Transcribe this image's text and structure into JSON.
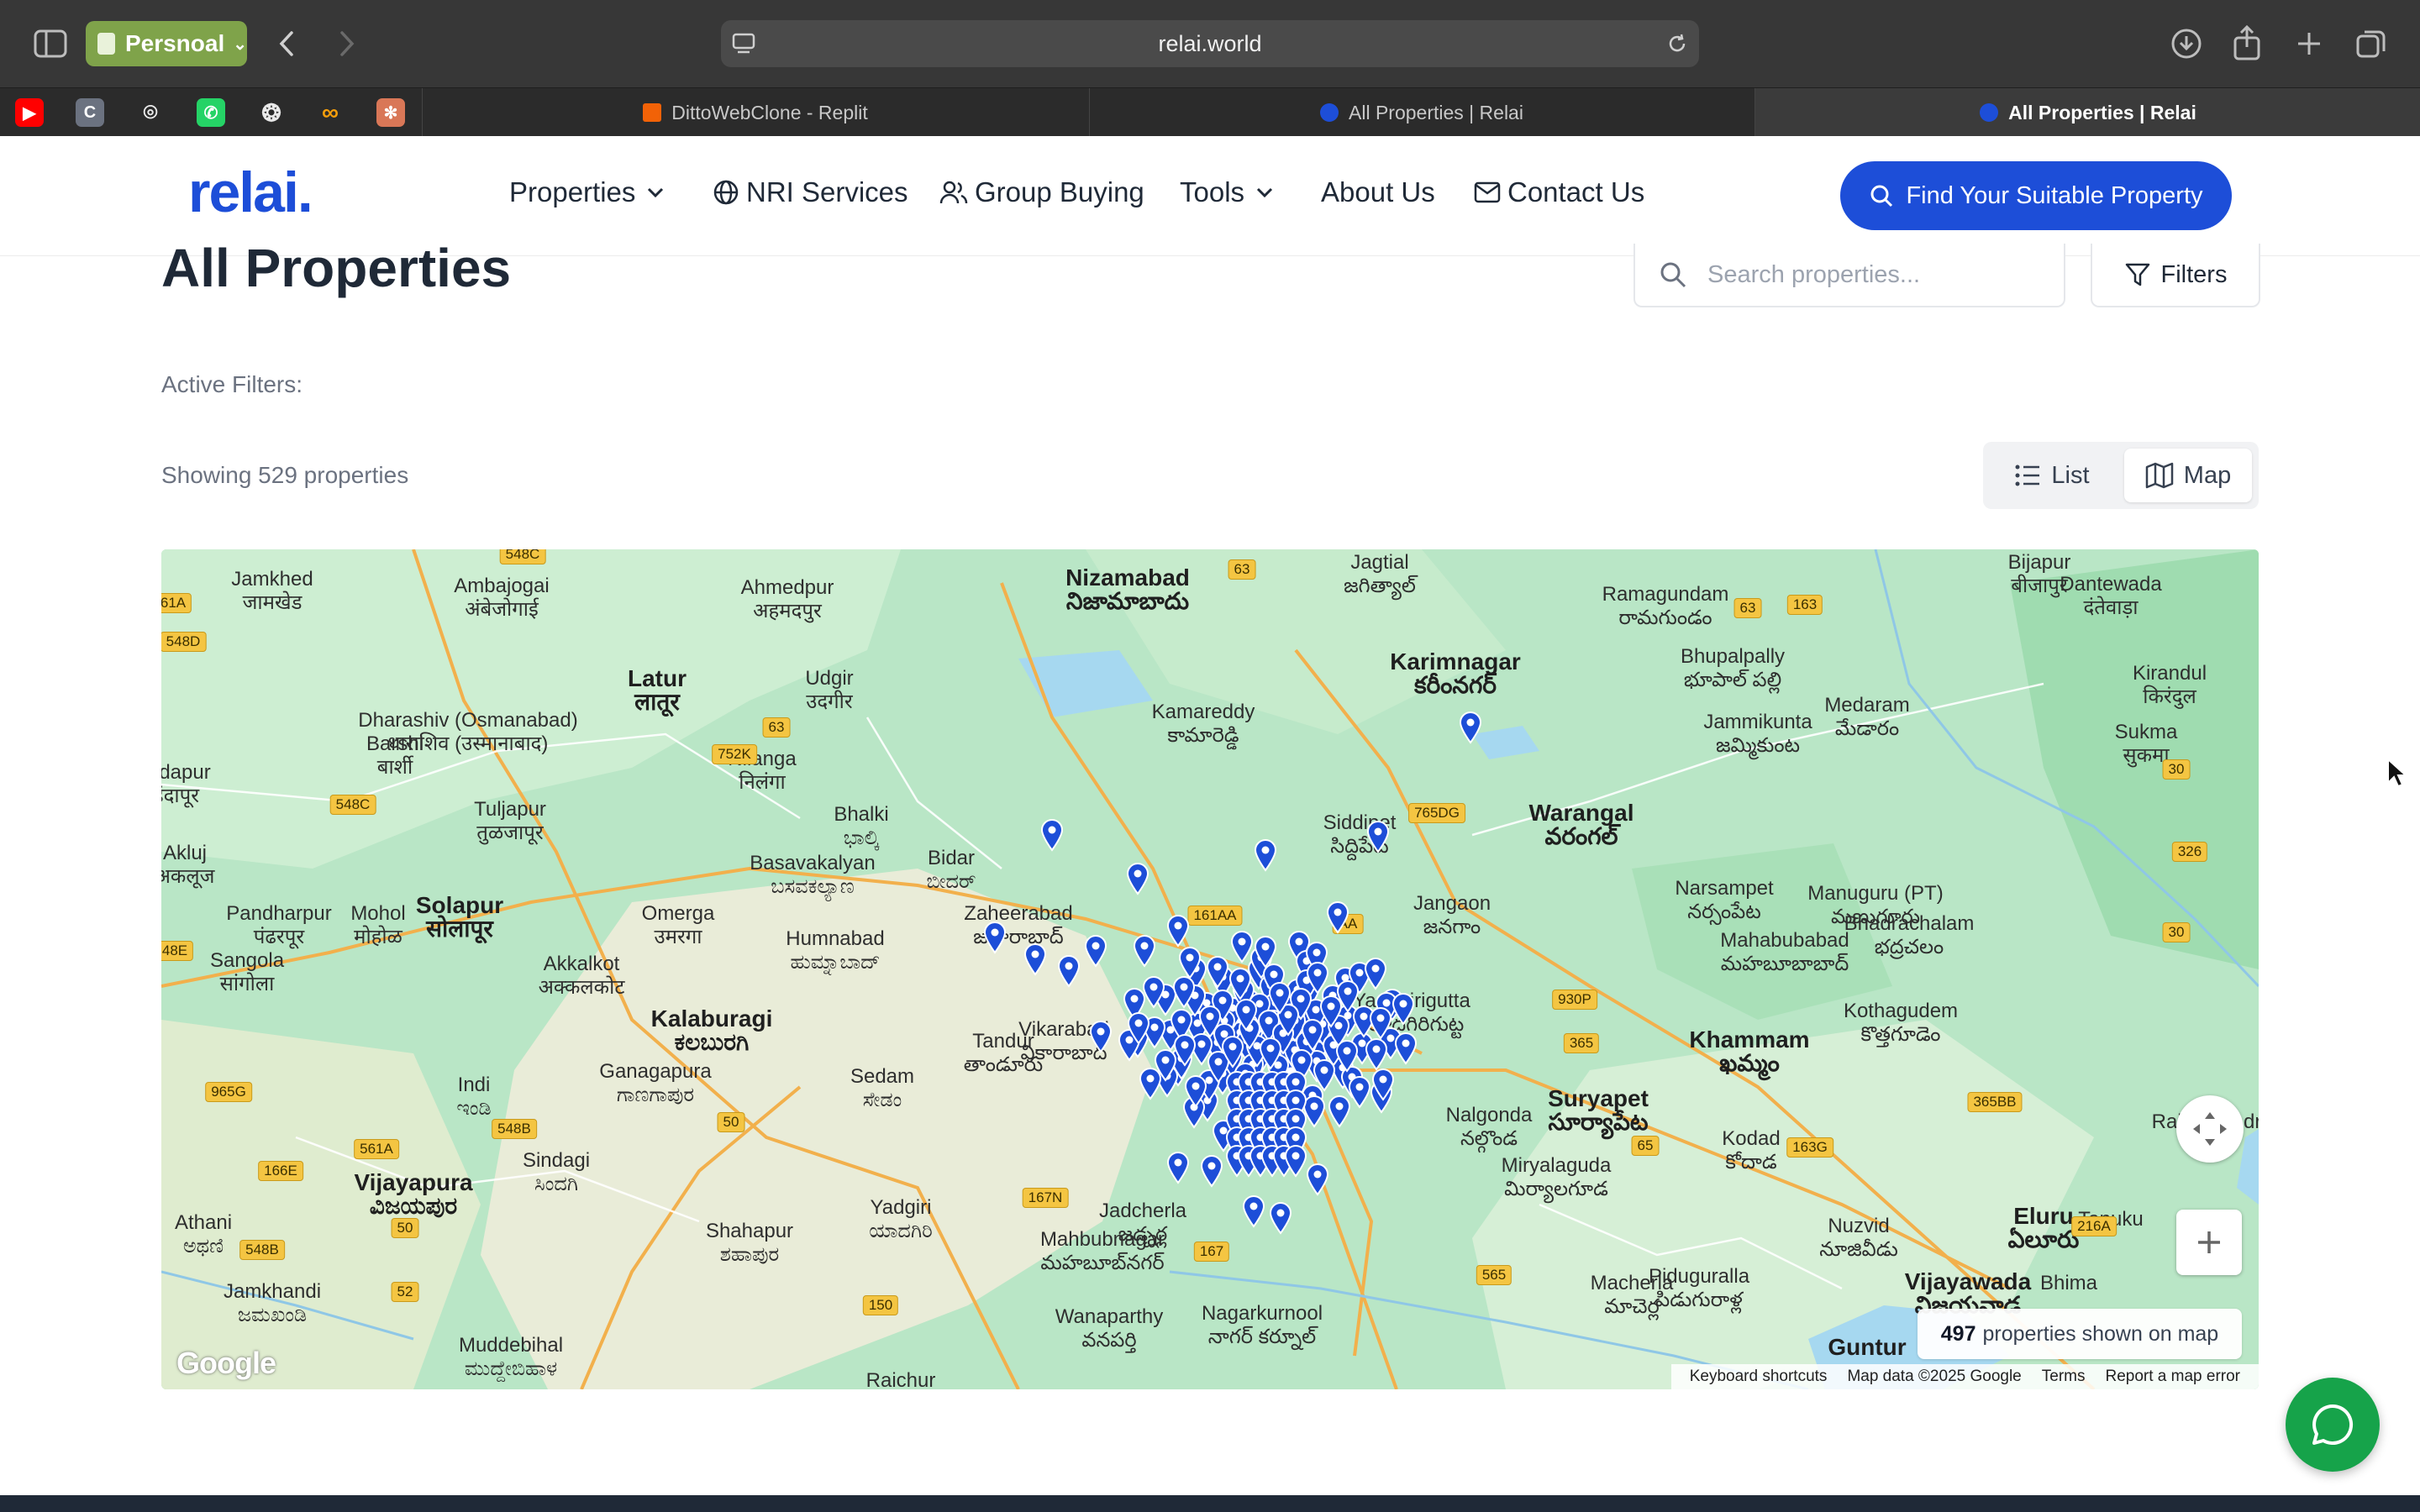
{
  "browser": {
    "profile_label": "Persnoal",
    "url": "relai.world",
    "favicons": [
      {
        "name": "youtube-icon",
        "color": "#ff0000",
        "glyph": "▶"
      },
      {
        "name": "c-icon",
        "color": "#6b7280",
        "glyph": "C"
      },
      {
        "name": "github-icon",
        "color": "#2b2b2b",
        "glyph": "⌾"
      },
      {
        "name": "whatsapp-icon",
        "color": "#25d366",
        "glyph": "✆"
      },
      {
        "name": "openai-icon",
        "color": "#2b2b2b",
        "glyph": "❂"
      },
      {
        "name": "infinity-icon",
        "color": "#2b2b2b",
        "glyph": "∞"
      },
      {
        "name": "claude-icon",
        "color": "#d97757",
        "glyph": "✻"
      }
    ],
    "tabs": [
      {
        "label": "DittoWebClone - Replit",
        "icon_color": "#f26207"
      },
      {
        "label": "All Properties | Relai",
        "icon_color": "#1d4ed8"
      },
      {
        "label": "All Properties | Relai",
        "icon_color": "#1d4ed8"
      }
    ]
  },
  "site": {
    "logo": "relai.",
    "nav": {
      "properties": "Properties",
      "nri": "NRI Services",
      "group": "Group Buying",
      "tools": "Tools",
      "about": "About Us",
      "contact": "Contact Us"
    },
    "cta": "Find Your Suitable Property",
    "brand_color": "#1d4ed8"
  },
  "page": {
    "title": "All Properties",
    "search_placeholder": "Search properties...",
    "filters_label": "Filters",
    "active_filters_label": "Active Filters:",
    "showing_text": "Showing 529 properties",
    "view_list": "List",
    "view_map": "Map",
    "selected_view": "Map"
  },
  "map": {
    "shown_count": "497",
    "shown_suffix": "properties shown on map",
    "google_label": "Google",
    "attribution": {
      "shortcuts": "Keyboard shortcuts",
      "data": "Map data ©2025 Google",
      "terms": "Terms",
      "report": "Report a map error"
    },
    "places": [
      {
        "name": "Nizamabad",
        "local": "నిజామాబాదు",
        "big": true
      },
      {
        "name": "Karimnagar",
        "local": "కరీంనగర్",
        "big": true
      },
      {
        "name": "Warangal",
        "local": "వరంగల్",
        "big": true
      },
      {
        "name": "Latur",
        "local": "लातूर",
        "big": true
      },
      {
        "name": "Solapur",
        "local": "सोलापूर",
        "big": true
      },
      {
        "name": "Kalaburagi",
        "local": "ಕಲಬುರಗಿ",
        "big": true
      },
      {
        "name": "Vijayapura",
        "local": "ವಿಜಯಪುರ",
        "big": true
      },
      {
        "name": "Suryapet",
        "local": "సూర్యాపేట",
        "big": true
      },
      {
        "name": "Khammam",
        "local": "ఖమ్మం",
        "big": true
      },
      {
        "name": "Eluru",
        "local": "ఏలూరు",
        "big": true
      },
      {
        "name": "Vijayawada",
        "local": "విజయవాడ",
        "big": true
      },
      {
        "name": "Guntur",
        "local": "",
        "big": true
      },
      {
        "name": "Jamkhed",
        "local": "जामखेड",
        "big": false
      },
      {
        "name": "Ambajogai",
        "local": "अंबेजोगाई",
        "big": false
      },
      {
        "name": "Ahmedpur",
        "local": "अहमदपुर",
        "big": false
      },
      {
        "name": "Udgir",
        "local": "उदगीर",
        "big": false
      },
      {
        "name": "Barshi",
        "local": "बार्शी",
        "big": false
      },
      {
        "name": "Dharashiv (Osmanabad)",
        "local": "धाराशिव (उस्मानाबाद)",
        "big": false
      },
      {
        "name": "Tuljapur",
        "local": "तुळजापूर",
        "big": false
      },
      {
        "name": "Nilanga",
        "local": "निलंगा",
        "big": false
      },
      {
        "name": "Bhalki",
        "local": "ಭಾಲ್ಕಿ",
        "big": false
      },
      {
        "name": "Bidar",
        "local": "ಬೀದರ್",
        "big": false
      },
      {
        "name": "Basavakalyan",
        "local": "ಬಸವಕಲ್ಯಾಣ",
        "big": false
      },
      {
        "name": "Kamareddy",
        "local": "కామారెడ్డి",
        "big": false
      },
      {
        "name": "Jagtial",
        "local": "జగిత్యాల్",
        "big": false
      },
      {
        "name": "Ramagundam",
        "local": "రామగుండం",
        "big": false
      },
      {
        "name": "Bhupalpally",
        "local": "భూపాల్ పల్లి",
        "big": false
      },
      {
        "name": "Medaram",
        "local": "మేడారం",
        "big": false
      },
      {
        "name": "Bijapur",
        "local": "बीजापुर",
        "big": false
      },
      {
        "name": "Dantewada",
        "local": "दंतेवाड़ा",
        "big": false
      },
      {
        "name": "Kirandul",
        "local": "किरंदुल",
        "big": false
      },
      {
        "name": "Sukma",
        "local": "सुकमा",
        "big": false
      },
      {
        "name": "Jammikunta",
        "local": "జమ్మికుంట",
        "big": false
      },
      {
        "name": "Siddipet",
        "local": "సిద్దిపేట",
        "big": false
      },
      {
        "name": "Jangaon",
        "local": "జనగాం",
        "big": false
      },
      {
        "name": "Narsampet",
        "local": "నర్సంపేట",
        "big": false
      },
      {
        "name": "Manuguru (PT)",
        "local": "మణుగూరు",
        "big": false
      },
      {
        "name": "Mahabubabad",
        "local": "మహబూబాబాద్",
        "big": false
      },
      {
        "name": "Bhadrachalam",
        "local": "భద్రచలం",
        "big": false
      },
      {
        "name": "Kothagudem",
        "local": "కొత్తగూడెం",
        "big": false
      },
      {
        "name": "Zaheerabad",
        "local": "జహీరాబాద్",
        "big": false
      },
      {
        "name": "Humnabad",
        "local": "ಹುಮ್ನಾಬಾದ್",
        "big": false
      },
      {
        "name": "Omerga",
        "local": "उमरगा",
        "big": false
      },
      {
        "name": "Mohol",
        "local": "मोहोळ",
        "big": false
      },
      {
        "name": "Akkalkot",
        "local": "अक्कलकोट",
        "big": false
      },
      {
        "name": "Pandharpur",
        "local": "पंढरपूर",
        "big": false
      },
      {
        "name": "Sangola",
        "local": "सांगोला",
        "big": false
      },
      {
        "name": "Akluj",
        "local": "अकलूज",
        "big": false
      },
      {
        "name": "Indapur",
        "local": "इंदापूर",
        "big": false
      },
      {
        "name": "Vikarabad",
        "local": "వికారాబాద్",
        "big": false
      },
      {
        "name": "Tandur",
        "local": "తాండూరు",
        "big": false
      },
      {
        "name": "Sedam",
        "local": "ಸೇಡಂ",
        "big": false
      },
      {
        "name": "Ganagapura",
        "local": "ಗಾಣಗಾಪುರ",
        "big": false
      },
      {
        "name": "Indi",
        "local": "ಇಂಡಿ",
        "big": false
      },
      {
        "name": "Sindagi",
        "local": "ಸಿಂದಗಿ",
        "big": false
      },
      {
        "name": "Yadgiri",
        "local": "ಯಾದಗಿರಿ",
        "big": false
      },
      {
        "name": "Shahapur",
        "local": "ಶಹಾಪುರ",
        "big": false
      },
      {
        "name": "Athani",
        "local": "ಅಥಣಿ",
        "big": false
      },
      {
        "name": "Jamkhandi",
        "local": "ಜಮಖಂಡಿ",
        "big": false
      },
      {
        "name": "Muddebihal",
        "local": "ಮುದ್ದೇಬಿಹಾಳ",
        "big": false
      },
      {
        "name": "Raichur",
        "local": "",
        "big": false
      },
      {
        "name": "Jadcherla",
        "local": "జడ్చర్ల",
        "big": false
      },
      {
        "name": "Mahbubnagar",
        "local": "మహబూబ్‌నగర్",
        "big": false
      },
      {
        "name": "Wanaparthy",
        "local": "వనపర్తి",
        "big": false
      },
      {
        "name": "Nagarkurnool",
        "local": "నాగర్ కర్నూల్",
        "big": false
      },
      {
        "name": "Yadagirigutta",
        "local": "యాదగిరిగుట్ట",
        "big": false
      },
      {
        "name": "Nalgonda",
        "local": "నల్గొండ",
        "big": false
      },
      {
        "name": "Miryalaguda",
        "local": "మిర్యాలగూడ",
        "big": false
      },
      {
        "name": "Macherla",
        "local": "మాచెర్ల",
        "big": false
      },
      {
        "name": "Piduguralla",
        "local": "పిడుగురాళ్ల",
        "big": false
      },
      {
        "name": "Kodad",
        "local": "కోదాడ",
        "big": false
      },
      {
        "name": "Nuzvid",
        "local": "నూజివీడు",
        "big": false
      },
      {
        "name": "Bhima",
        "local": "",
        "big": false
      },
      {
        "name": "Tanuku",
        "local": "",
        "big": false
      },
      {
        "name": "Rajahmundry",
        "local": "",
        "big": false
      }
    ],
    "roads": [
      "548C",
      "61A",
      "548D",
      "548C",
      "752K",
      "63",
      "63",
      "163",
      "63",
      "765DG",
      "161AA",
      "AA",
      "930P",
      "365",
      "326",
      "30",
      "30",
      "48E",
      "965G",
      "561A",
      "166E",
      "548B",
      "548B",
      "52",
      "50",
      "50",
      "167N",
      "167",
      "150",
      "565",
      "65",
      "163G",
      "365BB",
      "216A"
    ]
  }
}
